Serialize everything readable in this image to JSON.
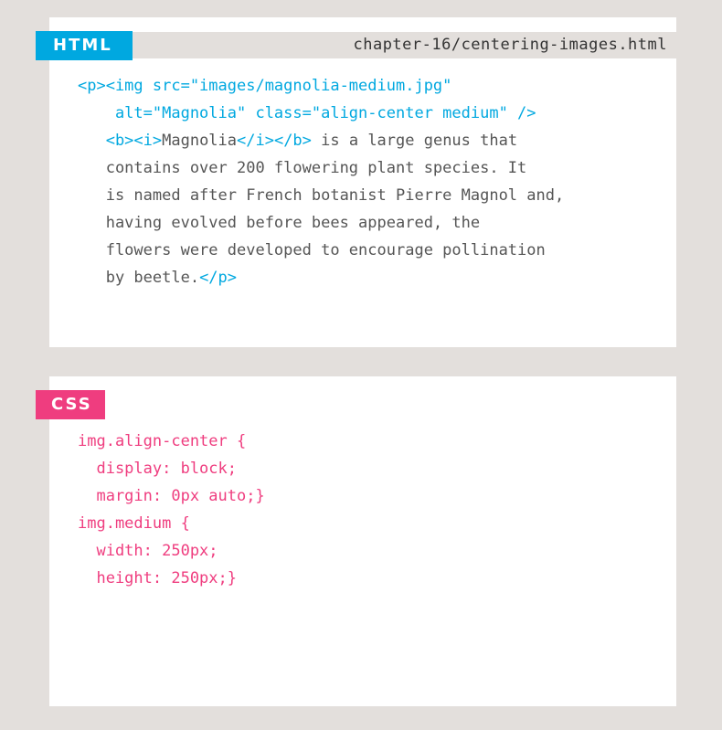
{
  "html_panel": {
    "tab_label": "HTML",
    "filename": "chapter-16/centering-images.html",
    "lines": [
      [
        {
          "t": "tag",
          "s": "<p><img src=\"images/magnolia-medium.jpg\""
        }
      ],
      [
        {
          "t": "tag",
          "s": "    alt=\"Magnolia\" class=\"align-center medium\" />"
        }
      ],
      [
        {
          "t": "tag",
          "s": "   <b><i>"
        },
        {
          "t": "txt",
          "s": "Magnolia"
        },
        {
          "t": "tag",
          "s": "</i></b>"
        },
        {
          "t": "txt",
          "s": " is a large genus that"
        }
      ],
      [
        {
          "t": "txt",
          "s": "   contains over 200 flowering plant species. It"
        }
      ],
      [
        {
          "t": "txt",
          "s": "   is named after French botanist Pierre Magnol and,"
        }
      ],
      [
        {
          "t": "txt",
          "s": "   having evolved before bees appeared, the"
        }
      ],
      [
        {
          "t": "txt",
          "s": "   flowers were developed to encourage pollination"
        }
      ],
      [
        {
          "t": "txt",
          "s": "   by beetle."
        },
        {
          "t": "tag",
          "s": "</p>"
        }
      ]
    ]
  },
  "css_panel": {
    "tab_label": "CSS",
    "lines": [
      "img.align-center {",
      "  display: block;",
      "  margin: 0px auto;}",
      "img.medium {",
      "  width: 250px;",
      "  height: 250px;}"
    ]
  },
  "colors": {
    "html_accent": "#00a8e0",
    "css_accent": "#ef3d7f",
    "background": "#e3dfdc",
    "body_text": "#555555"
  }
}
